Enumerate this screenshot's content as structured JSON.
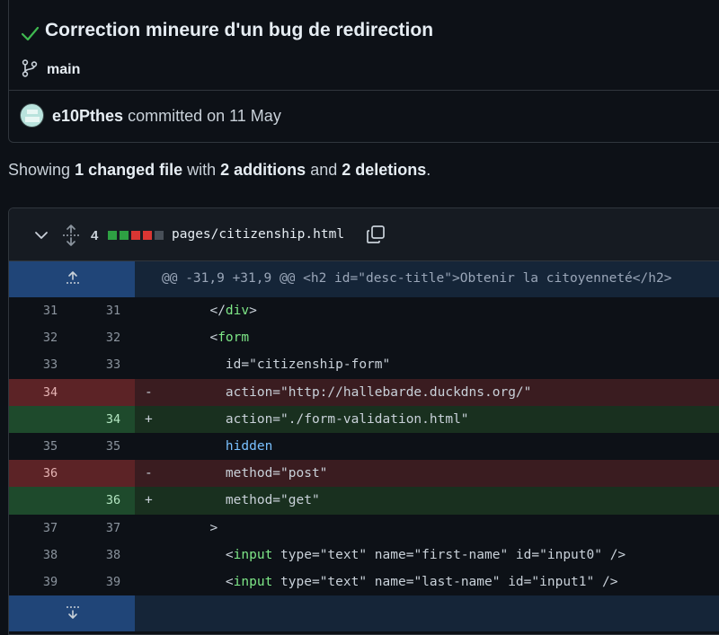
{
  "commit": {
    "title": "Correction mineure d'un bug de redirection",
    "branch": "main",
    "author": "e10Pthes",
    "committed_text": "committed on 11 May"
  },
  "summary": {
    "showing": "Showing",
    "files_changed": "1 changed file",
    "with": "with",
    "additions": "2 additions",
    "and": "and",
    "deletions": "2 deletions",
    "end": "."
  },
  "file": {
    "change_count": "4",
    "diffstat": [
      "add",
      "add",
      "del",
      "del",
      "neutral"
    ],
    "path": "pages/citizenship.html",
    "hunk_header": "@@ -31,9 +31,9 @@ <h2 id=\"desc-title\">Obtenir la citoyenneté</h2>"
  },
  "lines": [
    {
      "type": "ctx",
      "old": "31",
      "new": "31",
      "marker": "",
      "code": "  </div>"
    },
    {
      "type": "ctx",
      "old": "32",
      "new": "32",
      "marker": "",
      "code": "  <form"
    },
    {
      "type": "ctx",
      "old": "33",
      "new": "33",
      "marker": "",
      "code": "    id=\"citizenship-form\""
    },
    {
      "type": "del",
      "old": "34",
      "new": "",
      "marker": "-",
      "code": "    action=\"http://hallebarde.duckdns.org/\""
    },
    {
      "type": "add",
      "old": "",
      "new": "34",
      "marker": "+",
      "code": "    action=\"./form-validation.html\""
    },
    {
      "type": "ctx",
      "old": "35",
      "new": "35",
      "marker": "",
      "code": "    hidden"
    },
    {
      "type": "del",
      "old": "36",
      "new": "",
      "marker": "-",
      "code": "    method=\"post\""
    },
    {
      "type": "add",
      "old": "",
      "new": "36",
      "marker": "+",
      "code": "    method=\"get\""
    },
    {
      "type": "ctx",
      "old": "37",
      "new": "37",
      "marker": "",
      "code": "  >"
    },
    {
      "type": "ctx",
      "old": "38",
      "new": "38",
      "marker": "",
      "code": "    <input type=\"text\" name=\"first-name\" id=\"input0\" />"
    },
    {
      "type": "ctx",
      "old": "39",
      "new": "39",
      "marker": "",
      "code": "    <input type=\"text\" name=\"last-name\" id=\"input1\" />"
    }
  ],
  "colors": {
    "addition": "#2ea043",
    "deletion": "#da3633",
    "neutral": "#484f58",
    "hunk_gutter": "#204578"
  }
}
